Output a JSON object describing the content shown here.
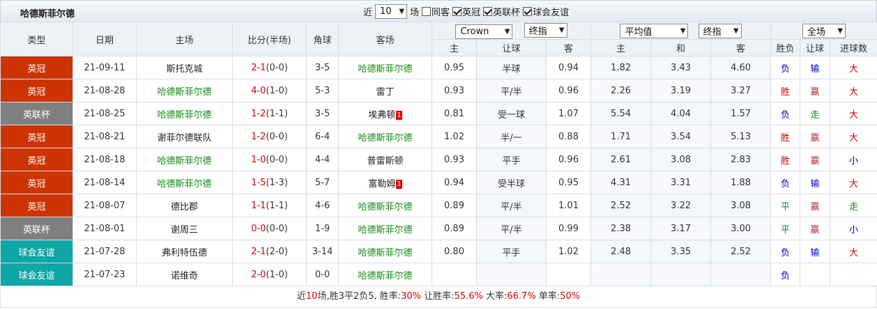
{
  "header": {
    "team_title": "哈德斯菲尔德",
    "filters": {
      "near_label": "近",
      "count_value": "10",
      "games_label": "场",
      "same_host_label": "同客",
      "leagues": [
        {
          "label": "英冠",
          "checked": true
        },
        {
          "label": "英联杯",
          "checked": true
        },
        {
          "label": "球会友谊",
          "checked": true
        }
      ]
    }
  },
  "table": {
    "columns": {
      "type": "类型",
      "date": "日期",
      "home": "主场",
      "score": "比分(半场)",
      "corners": "角球",
      "away": "客场"
    },
    "selects": {
      "company": "Crown",
      "odds_mode": "终指",
      "avg": "平均值",
      "odds_mode2": "终指",
      "scope": "全场"
    },
    "sub_headers": {
      "ah_home": "主",
      "ah_line": "让球",
      "ah_away": "客",
      "eu_home": "主",
      "eu_draw": "和",
      "eu_away": "客",
      "result": "胜负",
      "handicap": "让球",
      "goals": "进球数"
    },
    "rows": [
      {
        "league": "英冠",
        "league_color": "#cc3300",
        "date": "21-09-11",
        "home": "斯托克城",
        "home_is_team": false,
        "score_ft": "2-1",
        "score_ht": "(0-0)",
        "corners": "3-5",
        "away": "哈德斯菲尔德",
        "away_is_team": true,
        "away_red": "",
        "ah_home": "0.95",
        "ah_line": "半球",
        "ah_away": "0.94",
        "eu_home": "1.82",
        "eu_draw": "3.43",
        "eu_away": "4.60",
        "result": "负",
        "handicap": "输",
        "goals": "大"
      },
      {
        "league": "英冠",
        "league_color": "#cc3300",
        "date": "21-08-28",
        "home": "哈德斯菲尔德",
        "home_is_team": true,
        "score_ft": "4-0",
        "score_ht": "(1-0)",
        "corners": "5-3",
        "away": "雷丁",
        "away_is_team": false,
        "away_red": "",
        "ah_home": "0.93",
        "ah_line": "平/半",
        "ah_away": "0.96",
        "eu_home": "2.26",
        "eu_draw": "3.19",
        "eu_away": "3.27",
        "result": "胜",
        "handicap": "赢",
        "goals": "大"
      },
      {
        "league": "英联杯",
        "league_color": "#808080",
        "date": "21-08-25",
        "home": "哈德斯菲尔德",
        "home_is_team": true,
        "score_ft": "1-2",
        "score_ht": "(1-1)",
        "corners": "3-5",
        "away": "埃弗顿",
        "away_is_team": false,
        "away_red": "1",
        "ah_home": "0.81",
        "ah_line": "受一球",
        "ah_away": "1.07",
        "eu_home": "5.54",
        "eu_draw": "4.04",
        "eu_away": "1.57",
        "result": "负",
        "handicap": "走",
        "goals": "大"
      },
      {
        "league": "英冠",
        "league_color": "#cc3300",
        "date": "21-08-21",
        "home": "谢菲尔德联队",
        "home_is_team": false,
        "score_ft": "1-2",
        "score_ht": "(0-0)",
        "corners": "6-4",
        "away": "哈德斯菲尔德",
        "away_is_team": true,
        "away_red": "",
        "ah_home": "1.02",
        "ah_line": "半/一",
        "ah_away": "0.88",
        "eu_home": "1.71",
        "eu_draw": "3.54",
        "eu_away": "5.13",
        "result": "胜",
        "handicap": "赢",
        "goals": "大"
      },
      {
        "league": "英冠",
        "league_color": "#cc3300",
        "date": "21-08-18",
        "home": "哈德斯菲尔德",
        "home_is_team": true,
        "score_ft": "1-0",
        "score_ht": "(0-0)",
        "corners": "4-4",
        "away": "普雷斯顿",
        "away_is_team": false,
        "away_red": "",
        "ah_home": "0.93",
        "ah_line": "平手",
        "ah_away": "0.96",
        "eu_home": "2.61",
        "eu_draw": "3.08",
        "eu_away": "2.83",
        "result": "胜",
        "handicap": "赢",
        "goals": "小"
      },
      {
        "league": "英冠",
        "league_color": "#cc3300",
        "date": "21-08-14",
        "home": "哈德斯菲尔德",
        "home_is_team": true,
        "score_ft": "1-5",
        "score_ht": "(1-3)",
        "corners": "5-7",
        "away": "富勒姆",
        "away_is_team": false,
        "away_red": "1",
        "ah_home": "0.94",
        "ah_line": "受半球",
        "ah_away": "0.95",
        "eu_home": "4.31",
        "eu_draw": "3.31",
        "eu_away": "1.88",
        "result": "负",
        "handicap": "输",
        "goals": "大"
      },
      {
        "league": "英冠",
        "league_color": "#cc3300",
        "date": "21-08-07",
        "home": "德比郡",
        "home_is_team": false,
        "score_ft": "1-1",
        "score_ht": "(1-1)",
        "corners": "4-6",
        "away": "哈德斯菲尔德",
        "away_is_team": true,
        "away_red": "",
        "ah_home": "0.89",
        "ah_line": "平/半",
        "ah_away": "1.01",
        "eu_home": "2.52",
        "eu_draw": "3.22",
        "eu_away": "3.08",
        "result": "平",
        "handicap": "赢",
        "goals": "走"
      },
      {
        "league": "英联杯",
        "league_color": "#808080",
        "date": "21-08-01",
        "home": "谢周三",
        "home_is_team": false,
        "score_ft": "0-0",
        "score_ht": "(0-0)",
        "corners": "1-9",
        "away": "哈德斯菲尔德",
        "away_is_team": true,
        "away_red": "",
        "ah_home": "0.89",
        "ah_line": "平/半",
        "ah_away": "0.99",
        "eu_home": "2.38",
        "eu_draw": "3.17",
        "eu_away": "3.00",
        "result": "平",
        "handicap": "赢",
        "goals": "小"
      },
      {
        "league": "球会友谊",
        "league_color": "#0fa6a6",
        "date": "21-07-28",
        "home": "弗利特伍德",
        "home_is_team": false,
        "score_ft": "2-1",
        "score_ht": "(2-0)",
        "corners": "3-14",
        "away": "哈德斯菲尔德",
        "away_is_team": true,
        "away_red": "",
        "ah_home": "0.80",
        "ah_line": "平手",
        "ah_away": "1.02",
        "eu_home": "2.48",
        "eu_draw": "3.35",
        "eu_away": "2.52",
        "result": "负",
        "handicap": "输",
        "goals": "大"
      },
      {
        "league": "球会友谊",
        "league_color": "#0fa6a6",
        "date": "21-07-23",
        "home": "诺维奇",
        "home_is_team": false,
        "score_ft": "2-0",
        "score_ht": "(1-0)",
        "corners": "0-0",
        "away": "哈德斯菲尔德",
        "away_is_team": true,
        "away_red": "",
        "ah_home": "",
        "ah_line": "",
        "ah_away": "",
        "eu_home": "",
        "eu_draw": "",
        "eu_away": "",
        "result": "负",
        "handicap": "",
        "goals": ""
      }
    ]
  },
  "summary": {
    "parts": [
      {
        "text": "近",
        "hl": false
      },
      {
        "text": "10",
        "hl": true
      },
      {
        "text": "场,胜",
        "hl": false
      },
      {
        "text": "3",
        "hl": false
      },
      {
        "text": "平",
        "hl": false
      },
      {
        "text": "2",
        "hl": false
      },
      {
        "text": "负",
        "hl": false
      },
      {
        "text": "5",
        "hl": false
      },
      {
        "text": ", 胜率:",
        "hl": false
      },
      {
        "text": "30%",
        "hl": true
      },
      {
        "text": " 让胜率:",
        "hl": false
      },
      {
        "text": "55.6%",
        "hl": true
      },
      {
        "text": " 大率:",
        "hl": false
      },
      {
        "text": "66.7%",
        "hl": true
      },
      {
        "text": " 单率:",
        "hl": false
      },
      {
        "text": "50%",
        "hl": true
      }
    ]
  },
  "colors": {
    "team_highlight": "#128a12",
    "score_red": "#d40000",
    "result_loss": "#0000cc",
    "result_win": "#d40000",
    "result_draw": "#128a12"
  }
}
